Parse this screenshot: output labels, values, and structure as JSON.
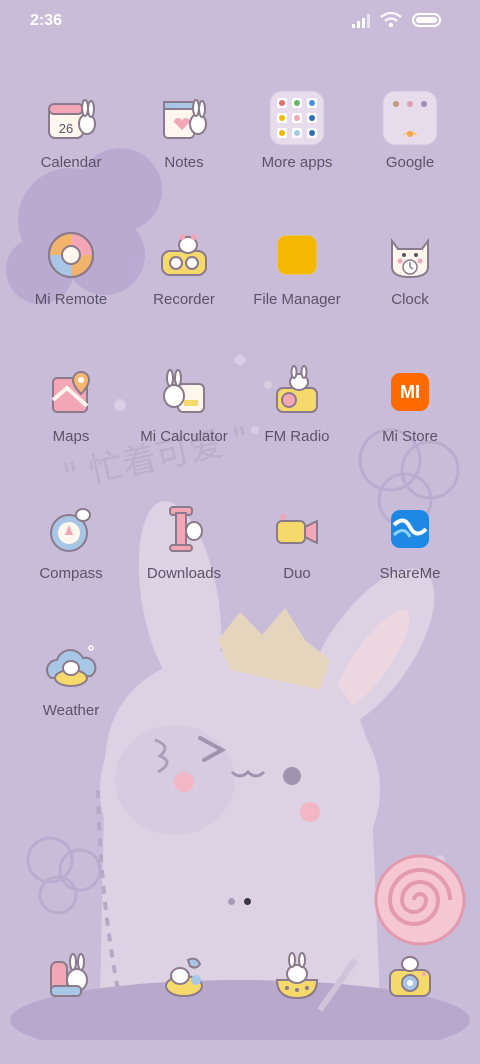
{
  "status_bar": {
    "time": "2:36"
  },
  "apps": [
    {
      "label": "Calendar",
      "icon": "calendar-bunny-icon",
      "badge": "26"
    },
    {
      "label": "Notes",
      "icon": "notes-bunny-icon"
    },
    {
      "label": "More apps",
      "icon": "folder-more-apps-icon"
    },
    {
      "label": "Google",
      "icon": "folder-google-icon"
    },
    {
      "label": "Mi Remote",
      "icon": "remote-icon"
    },
    {
      "label": "Recorder",
      "icon": "recorder-bunny-icon"
    },
    {
      "label": "File Manager",
      "icon": "file-manager-icon"
    },
    {
      "label": "Clock",
      "icon": "clock-cat-icon"
    },
    {
      "label": "Maps",
      "icon": "map-pin-icon"
    },
    {
      "label": "Mi Calculator",
      "icon": "calculator-bunny-icon"
    },
    {
      "label": "FM Radio",
      "icon": "radio-bunny-icon"
    },
    {
      "label": "Mi Store",
      "icon": "mi-store-icon",
      "glyph": "MI"
    },
    {
      "label": "Compass",
      "icon": "compass-bunny-icon"
    },
    {
      "label": "Downloads",
      "icon": "downloads-bunny-icon"
    },
    {
      "label": "Duo",
      "icon": "video-camera-icon"
    },
    {
      "label": "ShareMe",
      "icon": "shareme-icon"
    },
    {
      "label": "Weather",
      "icon": "weather-cloud-bunny-icon"
    }
  ],
  "dock": [
    {
      "icon": "phone-bunny-icon"
    },
    {
      "icon": "messages-bunny-icon"
    },
    {
      "icon": "browser-bunny-icon"
    },
    {
      "icon": "camera-bunny-icon"
    }
  ],
  "pager": {
    "pages": 2,
    "current": 2
  },
  "colors": {
    "background": "#c9bcd9",
    "label": "#5b5366",
    "file_manager": "#f5b800",
    "mi_store": "#ff6a00",
    "shareme": "#1e88e5"
  }
}
